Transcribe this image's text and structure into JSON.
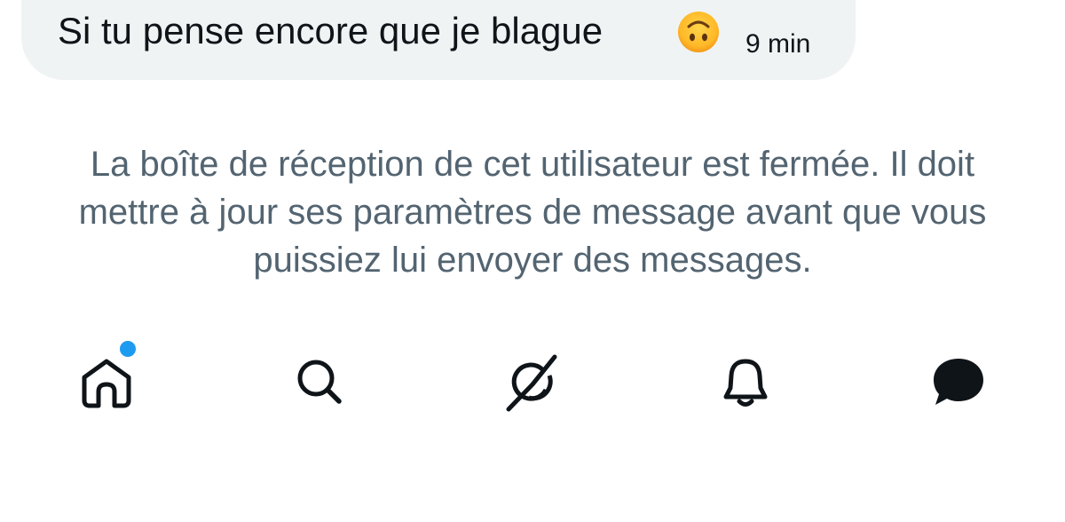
{
  "conversation": {
    "last_message": {
      "text": "Si tu pense encore que je blague",
      "emoji_icon": "upside-down-face-emoji",
      "timestamp": "9 min"
    },
    "closed_inbox_notice": "La boîte de réception de cet utilisateur est fermée. Il doit mettre à jour ses paramètres de message avant que vous puissiez lui envoyer des messages."
  },
  "bottom_nav": {
    "items": [
      {
        "icon": "home-icon",
        "has_badge": true,
        "badge_color": "#1d9bf0"
      },
      {
        "icon": "search-icon"
      },
      {
        "icon": "grok-icon"
      },
      {
        "icon": "bell-icon"
      },
      {
        "icon": "messages-icon",
        "active": true
      }
    ]
  },
  "colors": {
    "bubble_bg": "#eff3f4",
    "text_primary": "#0f1419",
    "text_secondary": "#536471",
    "accent": "#1d9bf0"
  }
}
